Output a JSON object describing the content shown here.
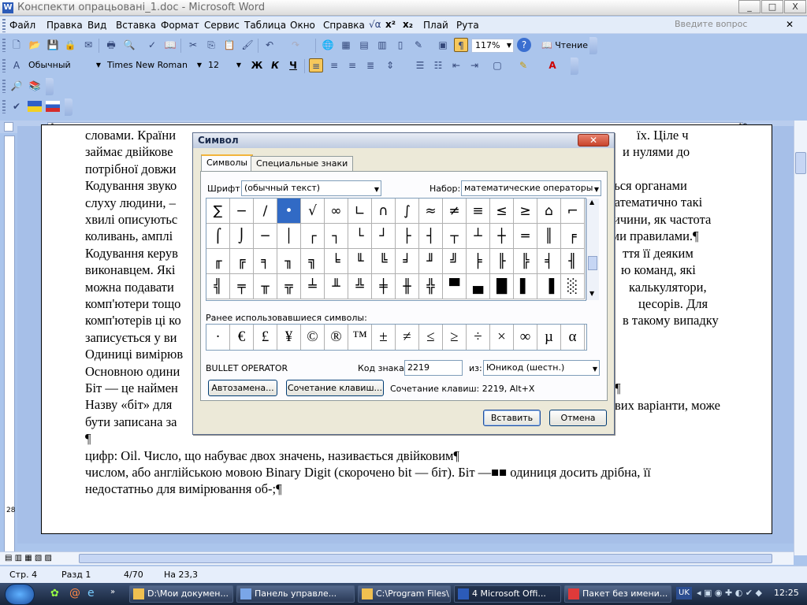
{
  "window": {
    "title": "Конспекти опрацьовані_1.doc - Microsoft Word",
    "ask_placeholder": "Введите вопрос",
    "buttons": {
      "minimize": "_",
      "maximize": "□",
      "close": "X"
    }
  },
  "menu": [
    "Файл",
    "Правка",
    "Вид",
    "Вставка",
    "Формат",
    "Сервис",
    "Таблица",
    "Окно",
    "Справка",
    "Плай",
    "Рута"
  ],
  "toolbar": {
    "zoom": "117%",
    "reading_label": "Чтение",
    "style": "Обычный",
    "font": "Times New Roman",
    "size": "12",
    "bold": "Ж",
    "italic": "К",
    "underline": "Ч"
  },
  "ruler": {
    "left_num": "1",
    "right_num": "19"
  },
  "vruler": {
    "num": "28"
  },
  "document": {
    "lines": [
      "словами. Країни",
      "займає двійкове",
      "потрібної довжи",
      "Кодування звуко",
      "слуху людини, –",
      "хвилі описуютьс",
      "коливань, амплі",
      "Кодування керув",
      "виконавцем. Які",
      "можна подавати",
      "комп'ютери тощо",
      "комп'ютерів ці ко",
      "записується у ви",
      "Одиниці вимірюв",
      "Основною одини",
      "Біт — це наймен",
      "Назву «біт» для",
      "бути записана за",
      "¶",
      "цифр: Oil. Число, що набуває двох значень, називається двійковим¶",
      "числом, або англійською мовою Binary Digit (скорочено bit — біт). Біт —■■ одиниця досить дрібна, її",
      "недостатньо для вимірювання об-;¶"
    ],
    "right_fragments": [
      "їх. Ціле ч",
      "и нулями до",
      "ться органами",
      "Математично такі",
      "ичини, як частота",
      "ними правилами.¶",
      "ття її деяким",
      "ю команд, які",
      "калькулятори,",
      "цесорів. Для",
      "в такому випадку",
      "¶",
      "вих варіанти, може"
    ]
  },
  "dialog": {
    "title": "Символ",
    "tabs": [
      "Символы",
      "Специальные знаки"
    ],
    "font_label": "Шрифт:",
    "font_value": "(обычный текст)",
    "set_label": "Набор:",
    "set_value": "математические операторы",
    "symbols": [
      [
        "∑",
        "−",
        "∕",
        "•",
        "√",
        "∞",
        "∟",
        "∩",
        "∫",
        "≈",
        "≠",
        "≡",
        "≤",
        "≥",
        "⌂",
        "⌐"
      ],
      [
        "⌠",
        "⌡",
        "─",
        "│",
        "┌",
        "┐",
        "└",
        "┘",
        "├",
        "┤",
        "┬",
        "┴",
        "┼",
        "═",
        "║",
        "╒"
      ],
      [
        "╓",
        "╔",
        "╕",
        "╖",
        "╗",
        "╘",
        "╙",
        "╚",
        "╛",
        "╜",
        "╝",
        "╞",
        "╟",
        "╠",
        "╡",
        "╢"
      ],
      [
        "╣",
        "╤",
        "╥",
        "╦",
        "╧",
        "╨",
        "╩",
        "╪",
        "╫",
        "╬",
        "▀",
        "▄",
        "█",
        "▌",
        "▐",
        "░"
      ]
    ],
    "selected_symbol": "•",
    "recent_label": "Ранее использовавшиеся символы:",
    "recent": [
      "·",
      "€",
      "£",
      "¥",
      "©",
      "®",
      "™",
      "±",
      "≠",
      "≤",
      "≥",
      "÷",
      "×",
      "∞",
      "µ",
      "α"
    ],
    "char_name": "BULLET OPERATOR",
    "code_label": "Код знака:",
    "code_value": "2219",
    "from_label": "из:",
    "from_value": "Юникод (шестн.)",
    "autocorrect_btn": "Автозамена...",
    "shortcut_btn": "Сочетание клавиш...",
    "shortcut_text": "Сочетание клавиш: 2219, Alt+X",
    "insert_btn": "Вставить",
    "cancel_btn": "Отмена"
  },
  "status": {
    "page": "Стр. 4",
    "section": "Разд 1",
    "pages": "4/70",
    "at": "На 23,3"
  },
  "taskbar": {
    "tasks": [
      "D:\\Мои докумен...",
      "Панель управле...",
      "C:\\Program Files\\...",
      "4 Microsoft Offi...",
      "Пакет без имени..."
    ],
    "lang": "UK",
    "clock": "12:25"
  }
}
